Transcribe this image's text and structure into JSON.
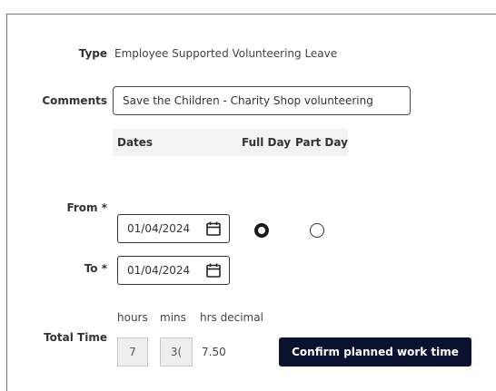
{
  "form": {
    "type_label": "Type",
    "type_value": "Employee Supported Volunteering Leave",
    "comments_label": "Comments",
    "comments_value": "Save the Children - Charity Shop volunteering",
    "dates_header": "Dates",
    "full_day_header": "Full Day",
    "part_day_header": "Part Day",
    "from_label": "From *",
    "from_date": "01/04/2024",
    "to_label": "To *",
    "to_date": "01/04/2024",
    "selected_option": "Full Day",
    "hours_label": "hours",
    "mins_label": "mins",
    "hrs_decimal_label": "hrs decimal",
    "total_time_label": "Total Time",
    "hours_value": "7",
    "mins_value": "3(",
    "hrs_decimal_value": "7.50",
    "confirm_button": "Confirm planned work time"
  },
  "colors": {
    "frame_border": "#4a7fc0",
    "button_bg": "#0b1230",
    "button_text": "#ffffff",
    "header_bg": "#f3f3f3",
    "disabled_box_bg": "#eeeeee"
  },
  "icons": {
    "date_picker": "calendar-icon"
  }
}
